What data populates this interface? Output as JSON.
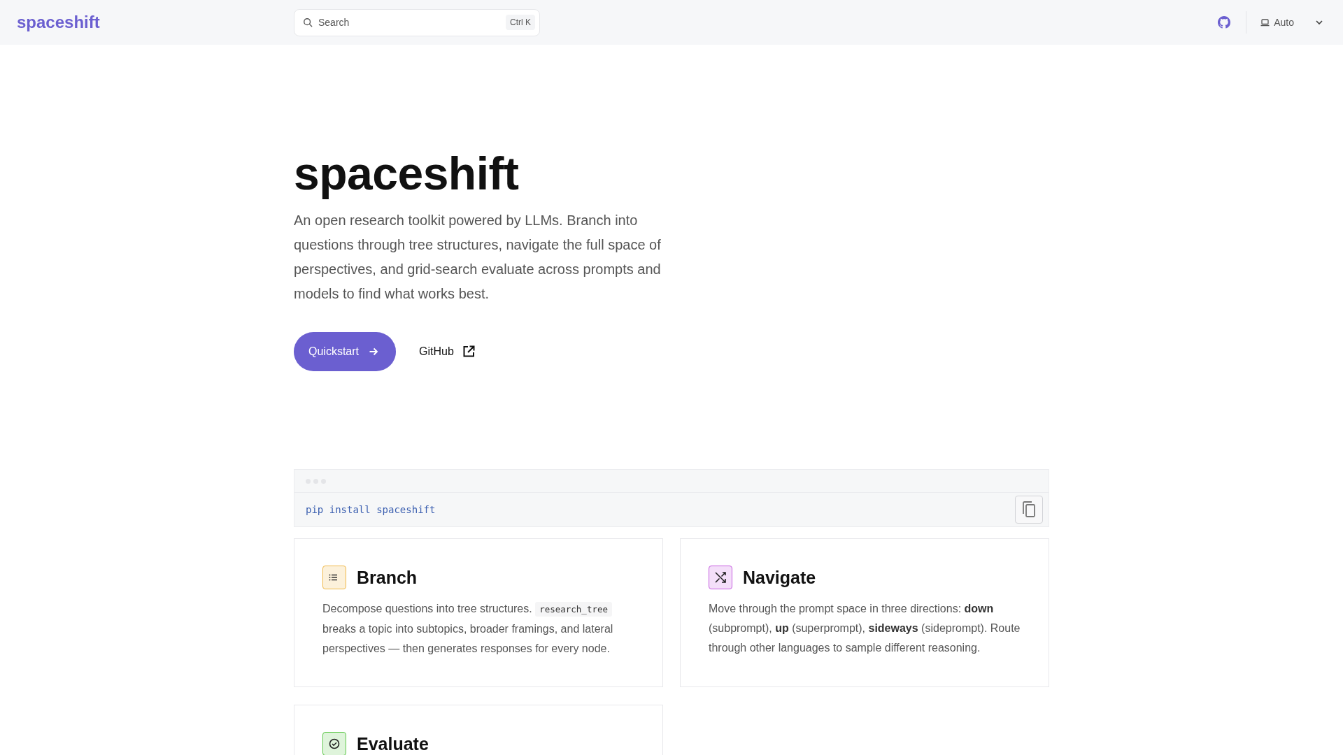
{
  "header": {
    "logo": "spaceshift",
    "search": {
      "placeholder": "Search",
      "shortcut": "Ctrl K"
    },
    "theme": "Auto"
  },
  "hero": {
    "title": "spaceshift",
    "description": "An open research toolkit powered by LLMs. Branch into questions through tree structures, navigate the full space of perspectives, and grid-search evaluate across prompts and models to find what works best.",
    "primary_button": "Quickstart",
    "secondary_link": "GitHub"
  },
  "code_block": {
    "code": "pip install spaceshift"
  },
  "cards": [
    {
      "title": "Branch",
      "kind": "list",
      "color": "#f0b94a",
      "description": [
        {
          "kind": "text",
          "text": "Decompose questions into tree structures."
        },
        {
          "kind": "code",
          "text": "research_tree"
        },
        {
          "kind": "text",
          "text": "breaks a topic into subtopics, broader framings, and lateral perspectives — then generates responses for every node."
        }
      ]
    },
    {
      "title": "Navigate",
      "kind": "shuffle",
      "color": "#c65de0",
      "description": [
        {
          "kind": "text",
          "text": "Move through the prompt space in three directions: **down** (subprompt), **up** (superprompt), **sideways** (sideprompt). Route through other languages to sample different reasoning."
        }
      ]
    },
    {
      "title": "Evaluate",
      "kind": "check",
      "color": "#5ec84a"
    }
  ]
}
